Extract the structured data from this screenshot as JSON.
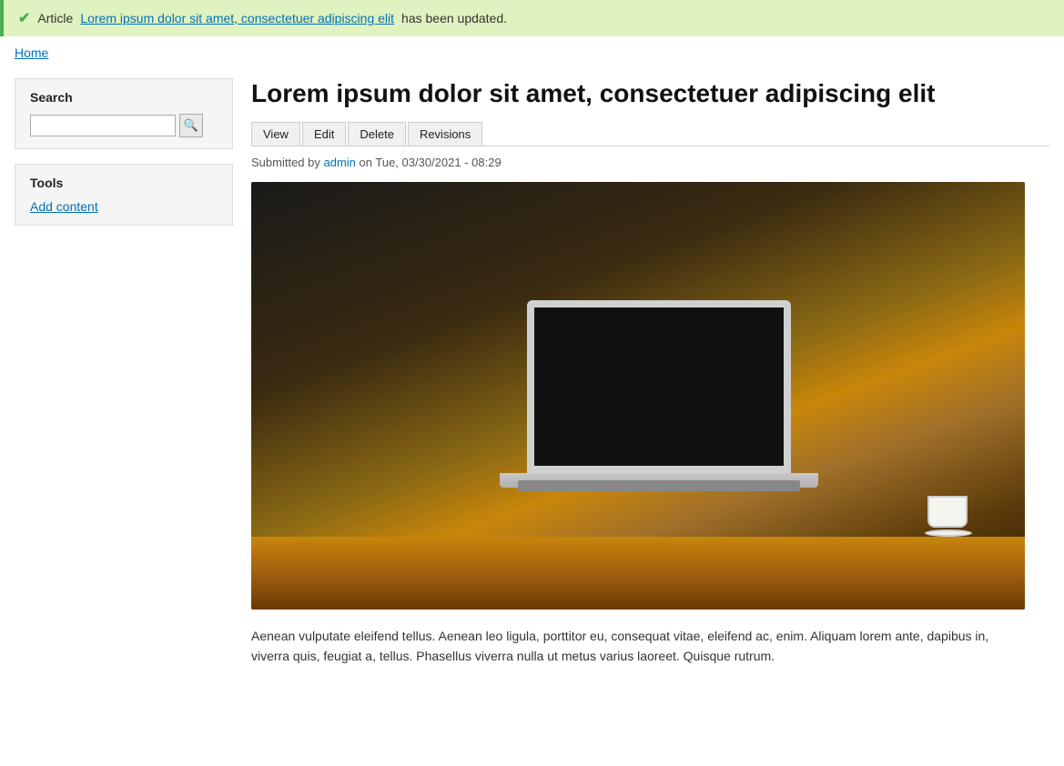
{
  "banner": {
    "message_prefix": "Article",
    "article_link_text": "Lorem ipsum dolor sit amet, consectetuer adipiscing elit",
    "message_suffix": "has been updated."
  },
  "breadcrumb": {
    "home_label": "Home"
  },
  "sidebar": {
    "search_label": "Search",
    "search_placeholder": "",
    "search_button_label": "🔍",
    "tools_label": "Tools",
    "add_content_label": "Add content"
  },
  "article": {
    "title": "Lorem ipsum dolor sit amet, consectetuer adipiscing elit",
    "tabs": [
      {
        "label": "View"
      },
      {
        "label": "Edit"
      },
      {
        "label": "Delete"
      },
      {
        "label": "Revisions"
      }
    ],
    "meta_prefix": "Submitted by",
    "author": "admin",
    "meta_suffix": "on Tue, 03/30/2021 - 08:29",
    "body": "Aenean vulputate eleifend tellus. Aenean leo ligula, porttitor eu, consequat vitae, eleifend ac, enim. Aliquam lorem ante, dapibus in, viverra quis, feugiat a, tellus. Phasellus viverra nulla ut metus varius laoreet. Quisque rutrum."
  }
}
